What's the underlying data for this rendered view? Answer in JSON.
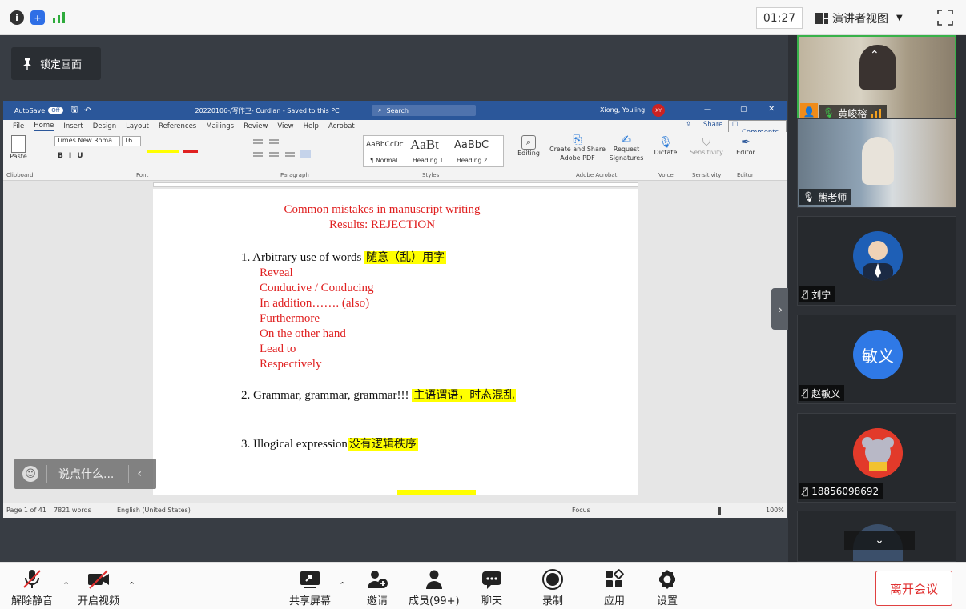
{
  "topbar": {
    "info_icon": "info-icon",
    "shield_icon": "shield-icon",
    "signal_icon": "signal-icon",
    "timer": "01:27",
    "view_label": "演讲者视图"
  },
  "stage": {
    "lock_label": "锁定画面"
  },
  "word": {
    "autosave": "AutoSave",
    "autosave_state": "Off",
    "filename": "20220106-/写作卫- Curdlan - Saved to this PC",
    "search_placeholder": "Search",
    "user": "Xiong, Youling",
    "user_initials": "XY",
    "menus": [
      "File",
      "Home",
      "Insert",
      "Design",
      "Layout",
      "References",
      "Mailings",
      "Review",
      "View",
      "Help",
      "Acrobat"
    ],
    "share": "Share",
    "comments": "Comments",
    "font_name": "Times New Roma",
    "font_size": "16",
    "styles": [
      {
        "preview": "AaBbCcDc",
        "name": "¶ Normal"
      },
      {
        "preview": "AaBt",
        "name": "Heading 1"
      },
      {
        "preview": "AaBbC",
        "name": "Heading 2"
      }
    ],
    "groups": [
      "Clipboard",
      "Font",
      "Paragraph",
      "Styles",
      "Adobe Acrobat",
      "Voice",
      "Sensitivity",
      "Editor"
    ],
    "paste": "Paste",
    "editing": "Editing",
    "create_share": "Create and Share Adobe PDF",
    "request_sig": "Request Signatures",
    "dictate": "Dictate",
    "sensitivity": "Sensitivity",
    "editor": "Editor",
    "status_page": "Page 1 of 41",
    "status_words": "7821 words",
    "status_lang": "English (United States)",
    "status_focus": "Focus",
    "zoom": "100%"
  },
  "doc": {
    "title1": "Common mistakes in manuscript writing",
    "title2": "Results: REJECTION",
    "item1_pre": "1. Arbitrary use of ",
    "item1_word": "words",
    "item1_hl": "随意（乱）用字",
    "item1_subs": [
      "Reveal",
      "Conducive / Conducing",
      "In addition……. (also)",
      "Furthermore",
      "On the other hand",
      "Lead to",
      "Respectively"
    ],
    "item2": "2. Grammar, grammar, grammar!!!",
    "item2_hl": "主语谓语，时态混乱",
    "item3": "3. Illogical expression",
    "item3_hl": "没有逻辑秩序"
  },
  "chat": {
    "placeholder": "说点什么..."
  },
  "participants": [
    {
      "name": "黄峻榕",
      "type": "video"
    },
    {
      "name": "熊老师",
      "type": "video"
    },
    {
      "name": "刘宁",
      "type": "photo"
    },
    {
      "name": "赵敏义",
      "type": "text",
      "avatar_text": "敏义"
    },
    {
      "name": "18856098692",
      "type": "cartoon"
    }
  ],
  "toolbar": {
    "unmute": "解除静音",
    "start_video": "开启视频",
    "share_screen": "共享屏幕",
    "invite": "邀请",
    "members": "成员(99+)",
    "chat": "聊天",
    "record": "录制",
    "apps": "应用",
    "settings": "设置",
    "leave": "离开会议"
  },
  "colors": {
    "accent_blue": "#2b579a",
    "doc_red": "#e02020",
    "highlight": "#ffff00",
    "active_green": "#38b24a",
    "leave_red": "#e03030"
  }
}
